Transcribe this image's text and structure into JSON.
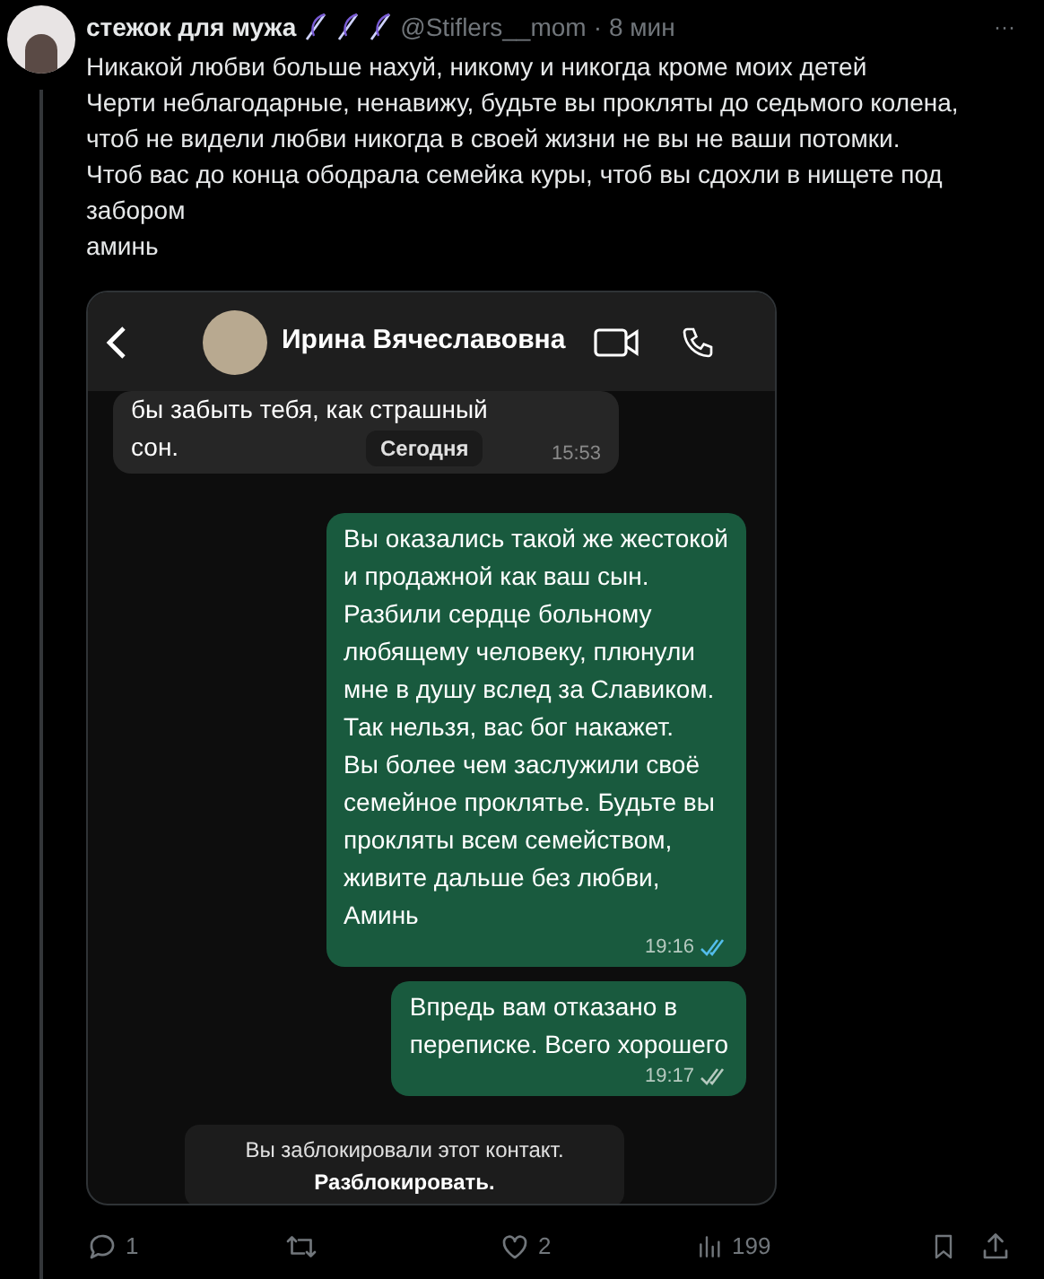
{
  "tweet": {
    "author": "стежок для мужа",
    "handle": "@Stiflers__mom",
    "separator": "·",
    "time": "8 мин",
    "more": "···",
    "lines": [
      "Никакой любви больше нахуй, никому и никогда кроме моих детей",
      "Черти неблагодарные, ненавижу, будьте вы прокляты до седьмого колена,",
      "чтоб не видели любви никогда в своей жизни не вы не ваши потомки.",
      "Чтоб вас до конца ободрала семейка куры, чтоб вы сдохли в нищете под",
      "забором",
      "аминь"
    ]
  },
  "chat": {
    "contact": "Ирина Вячеславовна",
    "date_chip": "Сегодня",
    "messages": [
      {
        "kind": "received",
        "lines": [
          "бы забыть тебя, как страшный",
          "сон."
        ],
        "time": "15:53"
      },
      {
        "kind": "sent",
        "lines": [
          "Вы оказались такой же жестокой",
          "и продажной как ваш сын.",
          "Разбили сердце больному",
          "любящему человеку, плюнули",
          "мне в душу вслед за Славиком.",
          "Так нельзя, вас бог накажет.",
          "Вы более чем заслужили своё",
          "семейное проклятье. Будьте вы",
          "прокляты всем семейством,",
          "живите дальше без любви,",
          "Аминь"
        ],
        "time": "19:16",
        "read": true
      },
      {
        "kind": "sent",
        "lines": [
          "Впредь вам отказано в",
          "переписке. Всего хорошего"
        ],
        "time": "19:17",
        "read": false
      }
    ],
    "blocked_notice": "Вы заблокировали этот контакт.",
    "unblock": "Разблокировать."
  },
  "actions": [
    {
      "kind": "reply",
      "count": "1"
    },
    {
      "kind": "retweet"
    },
    {
      "kind": "like",
      "count": "2"
    },
    {
      "kind": "views",
      "count": "199"
    },
    {
      "kind": "bookmark"
    },
    {
      "kind": "share"
    }
  ]
}
